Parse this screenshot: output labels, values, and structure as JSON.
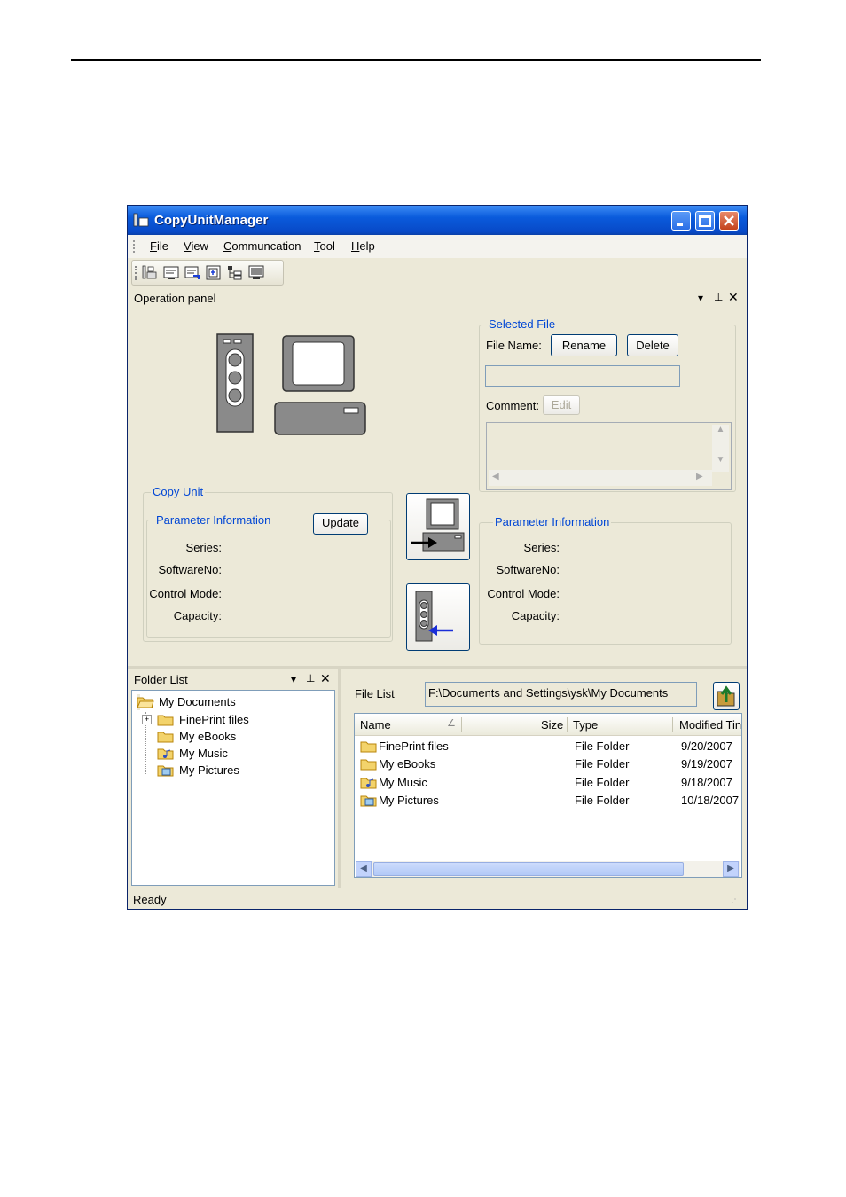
{
  "window": {
    "title": "CopyUnitManager"
  },
  "menu": [
    "File",
    "View",
    "Communcation",
    "Tool",
    "Help"
  ],
  "operation_panel": {
    "title": "Operation panel",
    "copy_unit": {
      "legend": "Copy Unit",
      "param_legend": "Parameter Information",
      "update_label": "Update",
      "labels": [
        "Series:",
        "SoftwareNo:",
        "Control Mode:",
        "Capacity:"
      ]
    },
    "selected_file": {
      "legend": "Selected File",
      "file_name_label": "File Name:",
      "rename_label": "Rename",
      "delete_label": "Delete",
      "comment_label": "Comment:",
      "edit_label": "Edit"
    },
    "right_params": {
      "legend": "Parameter Information",
      "labels": [
        "Series:",
        "SoftwareNo:",
        "Control Mode:",
        "Capacity:"
      ]
    }
  },
  "folder_list": {
    "title": "Folder List",
    "root": "My Documents",
    "items": [
      {
        "label": "FinePrint files",
        "icon": "folder-icon",
        "expandable": true
      },
      {
        "label": "My eBooks",
        "icon": "folder-icon",
        "expandable": false
      },
      {
        "label": "My Music",
        "icon": "music-folder-icon",
        "expandable": false
      },
      {
        "label": "My Pictures",
        "icon": "pictures-folder-icon",
        "expandable": false
      }
    ]
  },
  "file_list": {
    "label": "File List",
    "path": "F:\\Documents and Settings\\ysk\\My Documents",
    "columns": [
      "Name",
      "Size",
      "Type",
      "Modified Tin"
    ],
    "rows": [
      {
        "name": "FinePrint files",
        "size": "",
        "type": "File Folder",
        "modified": "9/20/2007",
        "icon": "folder-icon"
      },
      {
        "name": "My eBooks",
        "size": "",
        "type": "File Folder",
        "modified": "9/19/2007",
        "icon": "folder-icon"
      },
      {
        "name": "My Music",
        "size": "",
        "type": "File Folder",
        "modified": "9/18/2007",
        "icon": "music-folder-icon"
      },
      {
        "name": "My Pictures",
        "size": "",
        "type": "File Folder",
        "modified": "10/18/2007",
        "icon": "pictures-folder-icon"
      }
    ]
  },
  "status": {
    "text": "Ready"
  }
}
